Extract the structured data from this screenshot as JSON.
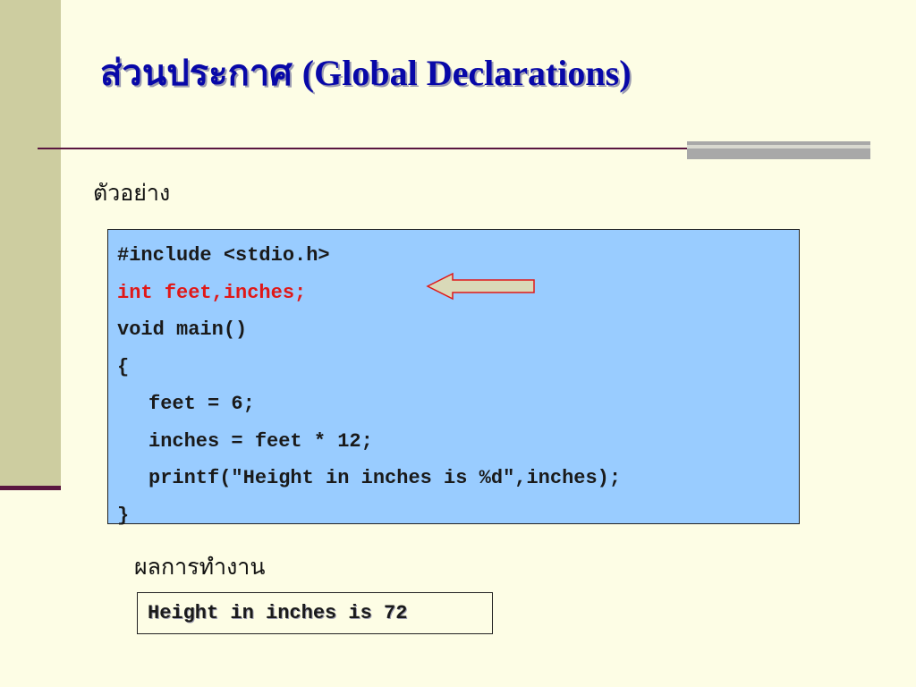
{
  "slide": {
    "title_thai": "ส่วนประกาศ",
    "title_latin": "(Global Declarations)",
    "example_label": "ตัวอย่าง",
    "code_lines": [
      "#include <stdio.h>",
      "int feet,inches;",
      "void main()",
      "{",
      "feet = 6;",
      "inches = feet * 12;",
      "printf(\"Height in inches is %d\",inches);",
      "}"
    ],
    "result_label": "ผลการทำงาน",
    "output_text": "Height in inches is 72"
  },
  "colors": {
    "background": "#fdfde5",
    "side_strip": "#cdcda0",
    "title": "#0808a8",
    "rule": "#5a1640",
    "code_background": "#99ccff",
    "highlight_code": "#e01818",
    "arrow_fill": "#d9d9b8",
    "arrow_stroke": "#e01818"
  },
  "icons": {
    "pointer": "left-arrow-icon"
  }
}
